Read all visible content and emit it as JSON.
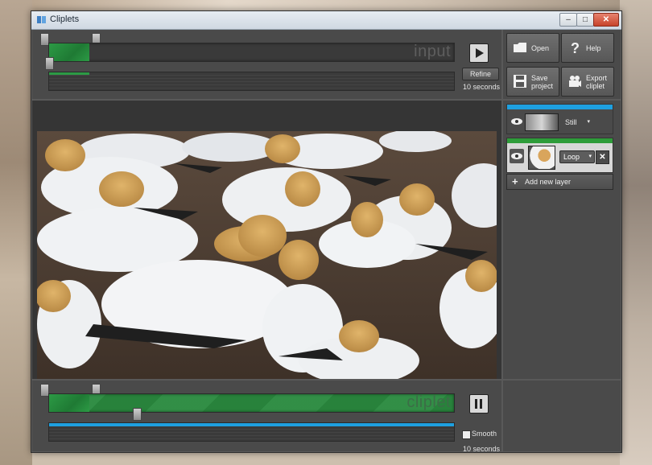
{
  "window": {
    "title": "Cliplets"
  },
  "input": {
    "track_label": "input",
    "refine_label": "Refine",
    "duration": "10 seconds"
  },
  "toolbar": {
    "open_label": "Open",
    "help_label": "Help",
    "save_label_1": "Save",
    "save_label_2": "project",
    "export_label_1": "Export",
    "export_label_2": "cliplet"
  },
  "layers": {
    "items": [
      {
        "mode": "Still",
        "bar_color": "#1ea0e0"
      },
      {
        "mode": "Loop",
        "bar_color": "#2e9c3a"
      }
    ],
    "add_label": "Add new layer"
  },
  "cliplet": {
    "track_label": "cliplet",
    "smooth_label": "Smooth",
    "duration": "10 seconds"
  },
  "colors": {
    "accent_green": "#2c9a45",
    "accent_blue": "#1ea0e0",
    "panel_bg": "#4a4a4a"
  }
}
